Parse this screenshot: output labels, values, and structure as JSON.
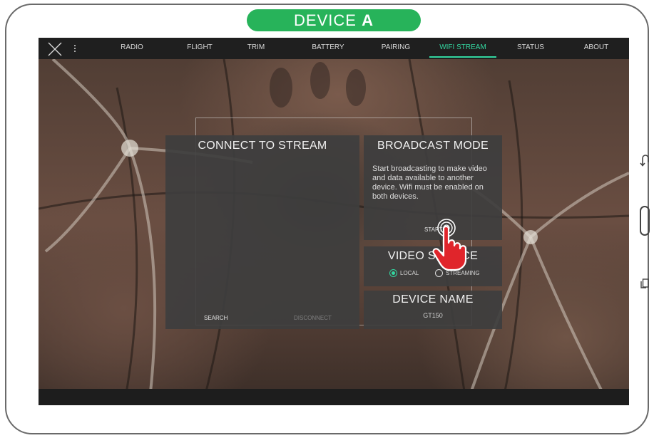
{
  "device_label": {
    "prefix": "DEVICE",
    "letter": "A"
  },
  "colors": {
    "accent": "#33d6a0",
    "device_pill": "#27b35a",
    "panel_bg": "#3e3e3e",
    "cursor": "#e0252b"
  },
  "icons": {
    "close": "close-icon",
    "more": "more-icon",
    "back": "back-icon",
    "home": "home-button",
    "recent": "recent-apps-icon",
    "cursor": "hand-pointer-icon"
  },
  "nav": {
    "tabs": [
      {
        "label": "RADIO"
      },
      {
        "label": "FLIGHT"
      },
      {
        "label": "TRIM"
      },
      {
        "label": "BATTERY"
      },
      {
        "label": "PAIRING"
      },
      {
        "label": "WIFI STREAM",
        "active": true
      },
      {
        "label": "STATUS"
      },
      {
        "label": "ABOUT"
      }
    ]
  },
  "connect_panel": {
    "title": "CONNECT TO STREAM",
    "search_label": "SEARCH",
    "disconnect_label": "DISCONNECT"
  },
  "broadcast_panel": {
    "title": "BROADCAST MODE",
    "description": "Start broadcasting to make video and data available to another device. Wifi must be enabled on both devices.",
    "start_label": "START"
  },
  "video_source_panel": {
    "title": "VIDEO SOURCE",
    "options": [
      {
        "label": "LOCAL",
        "selected": true
      },
      {
        "label": "STREAMING",
        "selected": false
      }
    ]
  },
  "device_name_panel": {
    "title": "DEVICE NAME",
    "value": "GT150"
  }
}
